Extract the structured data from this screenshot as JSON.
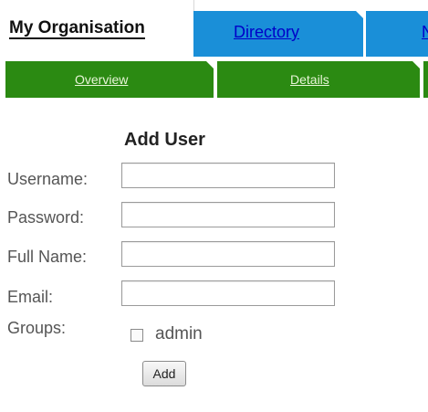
{
  "top_tabs": {
    "my_organisation": "My Organisation",
    "directory": "Directory",
    "third": "N"
  },
  "sub_tabs": {
    "overview": "Overview",
    "details": "Details"
  },
  "form": {
    "title": "Add User",
    "username_label": "Username:",
    "username_value": "",
    "password_label": "Password:",
    "password_value": "",
    "fullname_label": "Full Name:",
    "fullname_value": "",
    "email_label": "Email:",
    "email_value": "",
    "groups_label": "Groups:",
    "groups": [
      {
        "name": "admin",
        "checked": false
      }
    ],
    "add_button": "Add"
  },
  "colors": {
    "tab_blue": "#1a8fd8",
    "tab_link": "#0000c8",
    "subtab_green": "#2b8a12"
  }
}
